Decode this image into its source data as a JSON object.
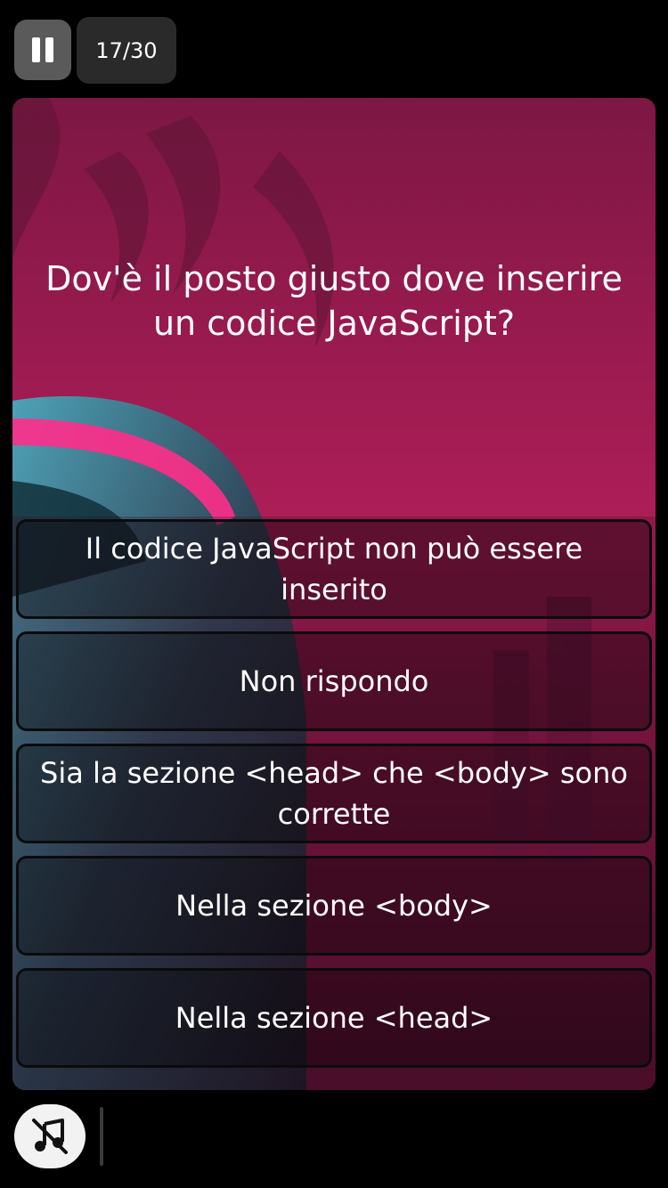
{
  "header": {
    "pause_icon": "pause-icon",
    "progress": "17/30"
  },
  "quiz": {
    "question": "Dov'è il posto giusto dove inserire un codice JavaScript?",
    "answers": [
      "Il codice JavaScript non può essere inserito",
      "Non rispondo",
      "Sia la sezione <head> che <body> sono corrette",
      "Nella sezione <body>",
      "Nella sezione <head>"
    ]
  },
  "footer": {
    "music_icon": "music-off-icon"
  },
  "colors": {
    "card_bg": "#a71c55",
    "answer_border": "#0b0b0b",
    "pause_button_bg": "#5a5a5a",
    "counter_bg": "#2a2a2a"
  }
}
